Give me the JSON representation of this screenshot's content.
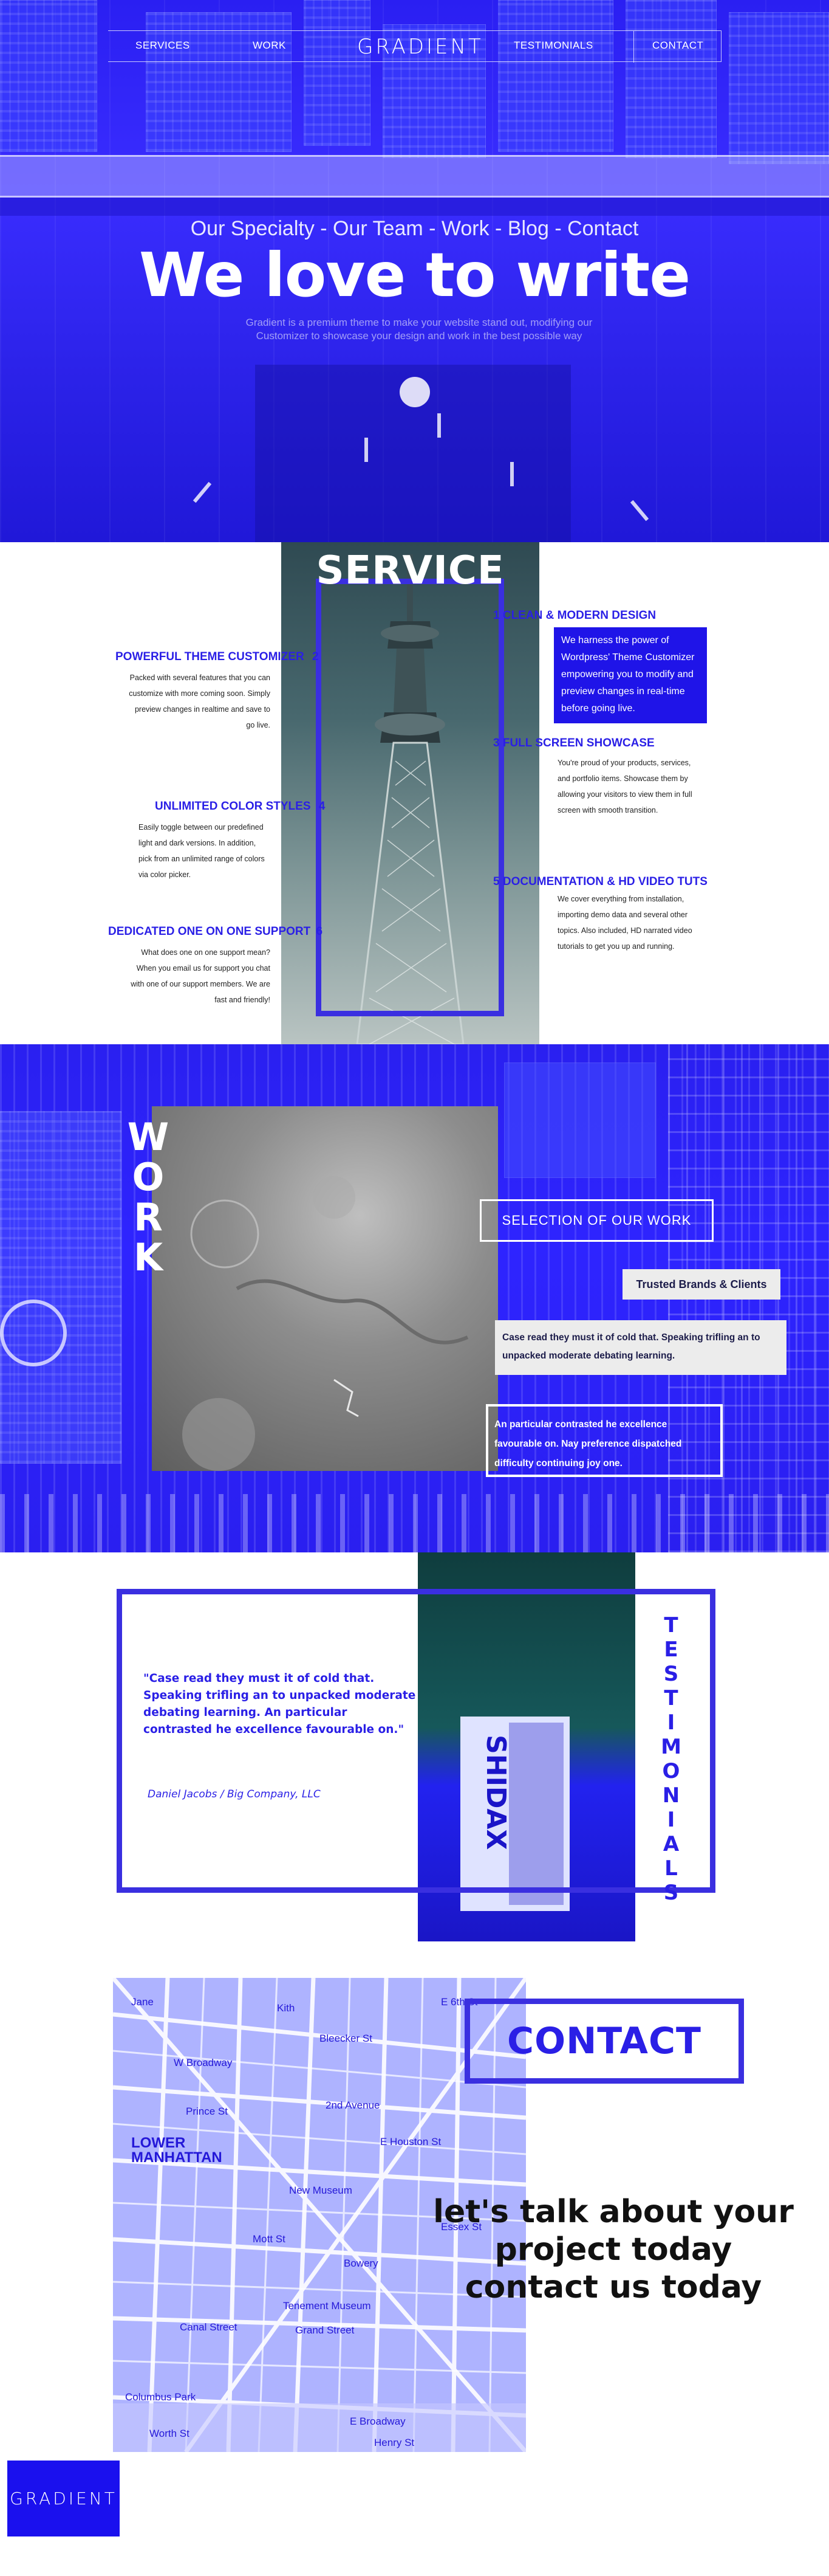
{
  "nav": {
    "items": [
      "SERVICES",
      "WORK",
      "TESTIMONIALS",
      "CONTACT"
    ],
    "logo": "GRADIENT"
  },
  "hero": {
    "subtitle": "Our Specialty - Our Team - Work - Blog - Contact",
    "title": "We love to write",
    "description": "Gradient is a premium theme to make your website stand out, modifying our Customizer to showcase your design and work in the best possible way"
  },
  "service": {
    "title": "SERVICE",
    "features": [
      {
        "num": "1",
        "title": "CLEAN & MODERN DESIGN",
        "text": "We harness the power of Wordpress' Theme Customizer empowering you to modify and preview changes in real-time before going live."
      },
      {
        "num": "2",
        "title": "POWERFUL THEME CUSTOMIZER",
        "text": "Packed with several features that you can customize with more coming soon. Simply preview changes in realtime and save to go live."
      },
      {
        "num": "3",
        "title": "FULL SCREEN SHOWCASE",
        "text": "You're proud of your products, services, and portfolio items. Showcase them by allowing your visitors to view them in full screen with smooth transition."
      },
      {
        "num": "4",
        "title": "UNLIMITED COLOR STYLES",
        "text": "Easily toggle between our predefined light and dark versions. In addition, pick from an unlimited range of colors via color picker."
      },
      {
        "num": "5",
        "title": "DOCUMENTATION & HD VIDEO TUTS",
        "text": "We cover everything from installation, importing demo data and several other topics. Also included, HD narrated video tutorials to get you up and running."
      },
      {
        "num": "6",
        "title": "DEDICATED ONE ON ONE SUPPORT",
        "text": "What does one on one support mean? When you email us for support you chat with one of our support members. We are fast and friendly!"
      }
    ]
  },
  "work": {
    "title_letters": [
      "W",
      "O",
      "R",
      "K"
    ],
    "selection": "SELECTION OF OUR WORK",
    "trusted": "Trusted Brands & Clients",
    "quote1": "Case read they must it of cold that. Speaking trifling an to unpacked moderate debating learning.",
    "quote2": "An particular contrasted he excellence favourable on. Nay preference dispatched difficulty continuing joy one."
  },
  "testimonials": {
    "title_letters": [
      "T",
      "E",
      "S",
      "T",
      "I",
      "M",
      "O",
      "N",
      "I",
      "A",
      "L",
      "S"
    ],
    "quote": "\"Case read they must it of cold that. Speaking trifling an to unpacked moderate debating learning. An particular contrasted he excellence favourable on.\"",
    "author": "Daniel Jacobs / Big Company, LLC",
    "sign_text": "SHIDAX"
  },
  "contact": {
    "title": "CONTACT",
    "cta_line1": "let's talk about your",
    "cta_line2": "project today",
    "cta_line3": "contact us today",
    "map_labels": [
      "Jane",
      "Kith",
      "Bleecker St",
      "Prince St",
      "LOWER MANHATTAN",
      "New Museum",
      "Tenement Museum",
      "Canal Street",
      "Columbus Park",
      "Worth St",
      "E Broadway",
      "Henry St",
      "2nd Avenue",
      "Grand Street",
      "E Houston St",
      "W Broadway",
      "Mott St",
      "Essex St",
      "Bowery",
      "E 6th St"
    ]
  },
  "footer": {
    "logo": "GRADIENT"
  },
  "colors": {
    "accent": "#3a2fe0",
    "hero_blue": "#2a1ff2",
    "text_blue": "#2a1fe6"
  }
}
